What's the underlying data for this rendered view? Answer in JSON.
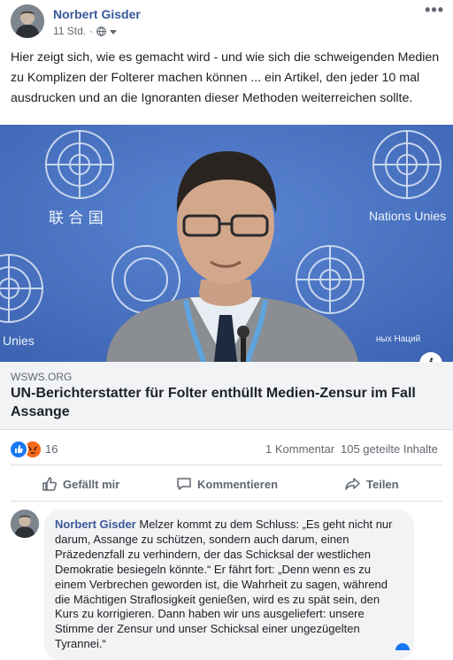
{
  "post": {
    "author": "Norbert Gisder",
    "time": "11 Std.",
    "separator": "·",
    "text": "Hier zeigt sich, wie es gemacht wird - und wie sich die schweigenden Medien zu Komplizen der Folterer machen können ... ein Artikel, den jeder 10 mal ausdrucken und an die Ignoranten dieser Methoden weiterreichen sollte."
  },
  "photo": {
    "cjk_text": "联 合 国",
    "banner_right": "Nations Unies",
    "banner_left": "Unies",
    "banner_bottom_right": "ных Наций"
  },
  "link": {
    "domain": "WSWS.ORG",
    "title": "UN-Berichterstatter für Folter enthüllt Medien-Zensur im Fall Assange"
  },
  "stats": {
    "reactions": "16",
    "comments": "1 Kommentar",
    "shares": "105 geteilte Inhalte"
  },
  "actions": {
    "like": "Gefällt mir",
    "comment": "Kommentieren",
    "share": "Teilen"
  },
  "comment": {
    "author": "Norbert Gisder",
    "text": "Melzer kommt zu dem Schluss: „Es geht nicht nur darum, Assange zu schützen, sondern auch darum, einen Präzedenzfall zu verhindern, der das Schicksal der westlichen Demokratie besiegeln könnte.“ Er fährt fort: „Denn wenn es zu einem Verbrechen geworden ist, die Wahrheit zu sagen, während die Mächtigen Straflosigkeit genießen, wird es zu spät sein, den Kurs zu korrigieren. Dann haben wir uns ausgeliefert: unsere Stimme der Zensur und unser Schicksal einer ungezügelten Tyrannei.“"
  },
  "colors": {
    "link_blue": "#385898",
    "facebook_blue": "#1877f2",
    "un_blue": "#4a74c3"
  }
}
